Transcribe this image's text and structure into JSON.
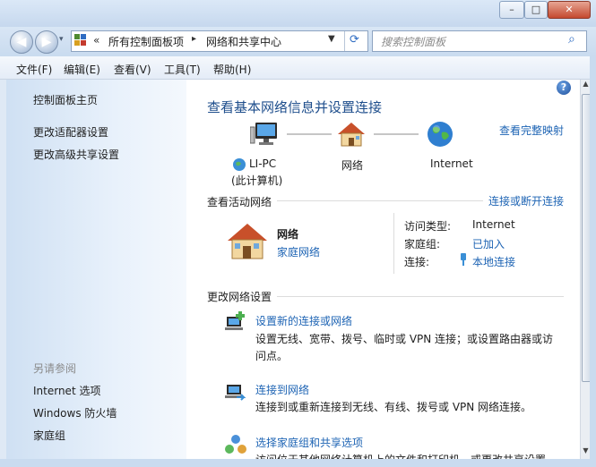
{
  "window": {
    "minimize_glyph": "▭",
    "maximize_glyph": "□",
    "close_glyph": "✕"
  },
  "nav": {
    "breadcrumb_overflow": "«",
    "breadcrumb_root": "所有控制面板项",
    "breadcrumb_sep": "▸",
    "breadcrumb_current": "网络和共享中心",
    "search_placeholder": "搜索控制面板"
  },
  "menu": {
    "file": "文件(F)",
    "edit": "编辑(E)",
    "view": "查看(V)",
    "tools": "工具(T)",
    "help": "帮助(H)"
  },
  "sidebar": {
    "home": "控制面板主页",
    "adapter": "更改适配器设置",
    "sharing": "更改高级共享设置",
    "see_also": "另请参阅",
    "internet_options": "Internet 选项",
    "firewall": "Windows 防火墙",
    "homegroup": "家庭组"
  },
  "main": {
    "title": "查看基本网络信息并设置连接",
    "full_map": "查看完整映射",
    "map": {
      "pc_name": "LI-PC",
      "pc_sub": "(此计算机)",
      "network": "网络",
      "internet": "Internet"
    },
    "active_title": "查看活动网络",
    "connect_disconnect": "连接或断开连接",
    "active": {
      "name": "网络",
      "type": "家庭网络",
      "access_label": "访问类型:",
      "access_value": "Internet",
      "homegroup_label": "家庭组:",
      "homegroup_value": "已加入",
      "connection_label": "连接:",
      "connection_value": "本地连接"
    },
    "settings_title": "更改网络设置",
    "tasks": [
      {
        "title": "设置新的连接或网络",
        "desc1": "设置无线、宽带、拨号、临时或 VPN 连接；或设置路由器或访",
        "desc2": "问点。"
      },
      {
        "title": "连接到网络",
        "desc1": "连接到或重新连接到无线、有线、拨号或 VPN 网络连接。",
        "desc2": ""
      },
      {
        "title": "选择家庭组和共享选项",
        "desc1": "访问位于其他网络计算机上的文件和打印机，或更改共享设置",
        "desc2": ""
      }
    ]
  }
}
